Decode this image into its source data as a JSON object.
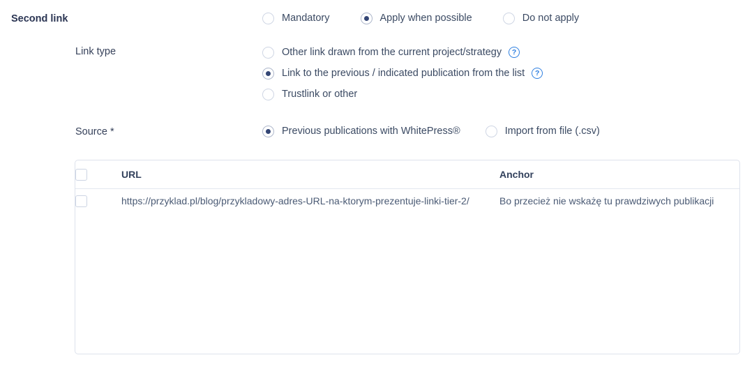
{
  "second_link": {
    "label": "Second link",
    "options": [
      {
        "label": "Mandatory",
        "selected": false
      },
      {
        "label": "Apply when possible",
        "selected": true
      },
      {
        "label": "Do not apply",
        "selected": false
      }
    ]
  },
  "link_type": {
    "label": "Link type",
    "options": [
      {
        "label": "Other link drawn from the current project/strategy",
        "selected": false,
        "help": true
      },
      {
        "label": "Link to the previous / indicated publication from the list",
        "selected": true,
        "help": true
      },
      {
        "label": "Trustlink or other",
        "selected": false,
        "help": false
      }
    ],
    "help_glyph": "?"
  },
  "source": {
    "label": "Source *",
    "options": [
      {
        "label": "Previous publications with WhitePress®",
        "selected": true
      },
      {
        "label": "Import from file (.csv)",
        "selected": false
      }
    ]
  },
  "publications_table": {
    "columns": [
      "URL",
      "Anchor"
    ],
    "select_all_checked": false,
    "rows": [
      {
        "checked": false,
        "url": "https://przyklad.pl/blog/przykladowy-adres-URL-na-ktorym-prezentuje-linki-tier-2/",
        "anchor": "Bo przecież nie wskażę tu prawdziwych publikacji"
      }
    ]
  },
  "colors": {
    "accent_blue": "#2e7fe0",
    "radio_selected_dot": "#344675",
    "text_primary": "#3c4858",
    "border": "#dde2ec"
  }
}
